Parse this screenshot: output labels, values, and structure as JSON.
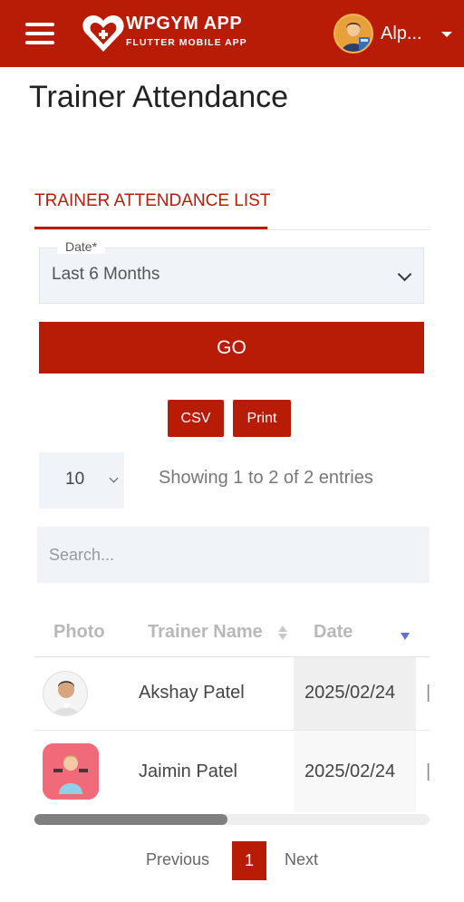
{
  "header": {
    "brand_title": "WPGYM APP",
    "brand_subtitle": "FLUTTER MOBILE APP",
    "user_name": "Alp...",
    "accent_color": "#b81c07"
  },
  "page": {
    "title": "Trainer Attendance"
  },
  "tabs": [
    {
      "label": "TRAINER ATTENDANCE LIST",
      "active": true
    }
  ],
  "filter": {
    "date_label": "Date*",
    "date_value": "Last 6 Months",
    "go_label": "GO"
  },
  "export": {
    "csv_label": "CSV",
    "print_label": "Print"
  },
  "table_controls": {
    "page_length": "10",
    "info": "Showing 1 to 2 of 2 entries",
    "search_placeholder": "Search..."
  },
  "table": {
    "columns": [
      "Photo",
      "Trainer Name",
      "Date"
    ],
    "rows": [
      {
        "name": "Akshay Patel",
        "date": "2025/02/24"
      },
      {
        "name": "Jaimin Patel",
        "date": "2025/02/24"
      }
    ]
  },
  "pagination": {
    "previous": "Previous",
    "current": "1",
    "next": "Next"
  }
}
